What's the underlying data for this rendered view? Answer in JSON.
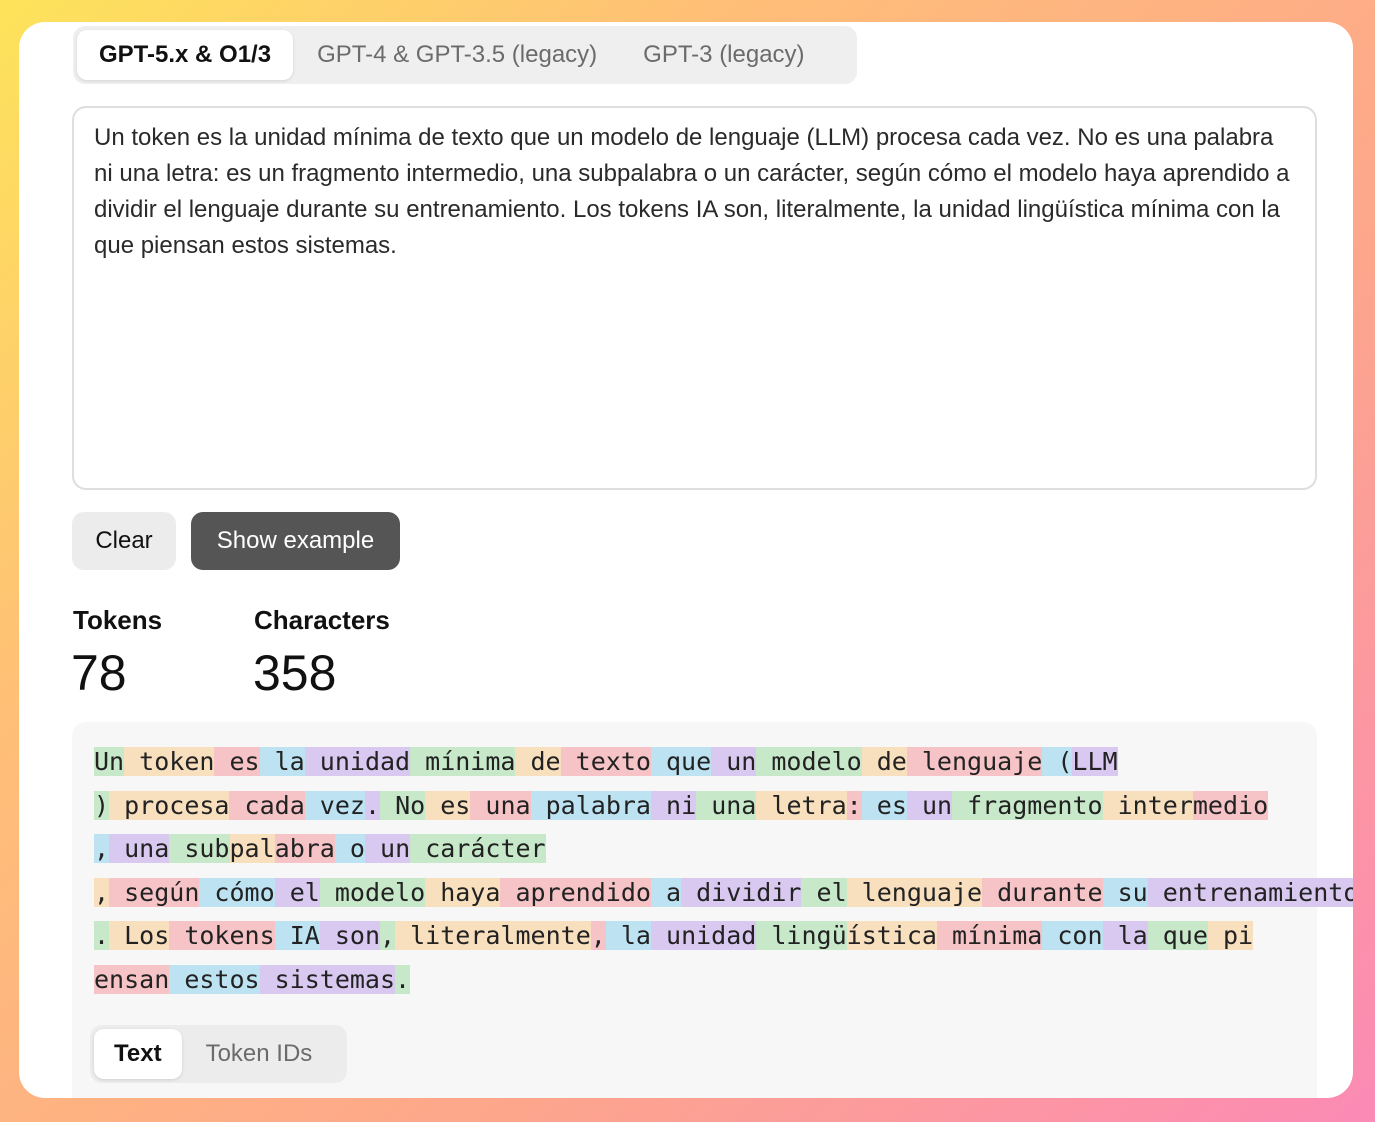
{
  "model_tabs": [
    {
      "label": "GPT-5.x & O1/3",
      "active": true
    },
    {
      "label": "GPT-4 & GPT-3.5 (legacy)",
      "active": false
    },
    {
      "label": "GPT-3 (legacy)",
      "active": false
    }
  ],
  "input_text": "Un token es la unidad mínima de texto que un modelo de lenguaje (LLM) procesa cada vez. No es una palabra ni una letra: es un fragmento intermedio, una subpalabra o un carácter, según cómo el modelo haya aprendido a dividir el lenguaje durante su entrenamiento. Los tokens IA son, literalmente, la unidad lingüística mínima con la que piensan estos sistemas.",
  "buttons": {
    "clear": "Clear",
    "show_example": "Show example"
  },
  "stats": {
    "tokens_label": "Tokens",
    "tokens_value": "78",
    "characters_label": "Characters",
    "characters_value": "358"
  },
  "token_colors": [
    "#c7e8c9",
    "#f8dfbd",
    "#f6c3c7",
    "#bde3f3",
    "#d9c9f1"
  ],
  "tokens": [
    "Un",
    " token",
    " es",
    " la",
    " unidad",
    " mínima",
    " de",
    " texto",
    " que",
    " un",
    " modelo",
    " de",
    " lenguaje",
    " (",
    "LLM",
    ")",
    " procesa",
    " cada",
    " vez",
    ".",
    " No",
    " es",
    " una",
    " palabra",
    " ni",
    " una",
    " letra",
    ":",
    " es",
    " un",
    " fragmento",
    " inter",
    "medio",
    ",",
    " una",
    " sub",
    "pal",
    "abra",
    " o",
    " un",
    " carácter",
    ",",
    " según",
    " cómo",
    " el",
    " modelo",
    " haya",
    " aprendido",
    " a",
    " dividir",
    " el",
    " lenguaje",
    " durante",
    " su",
    " entrenamiento",
    ".",
    " Los",
    " tokens",
    " IA",
    " son",
    ",",
    " literalmente",
    ",",
    " la",
    " unidad",
    " lingü",
    "ística",
    " mínima",
    " con",
    " la",
    " que",
    " pi",
    "ensan",
    " estos",
    " sistemas",
    "."
  ],
  "view_tabs": [
    {
      "label": "Text",
      "active": true
    },
    {
      "label": "Token IDs",
      "active": false
    }
  ]
}
